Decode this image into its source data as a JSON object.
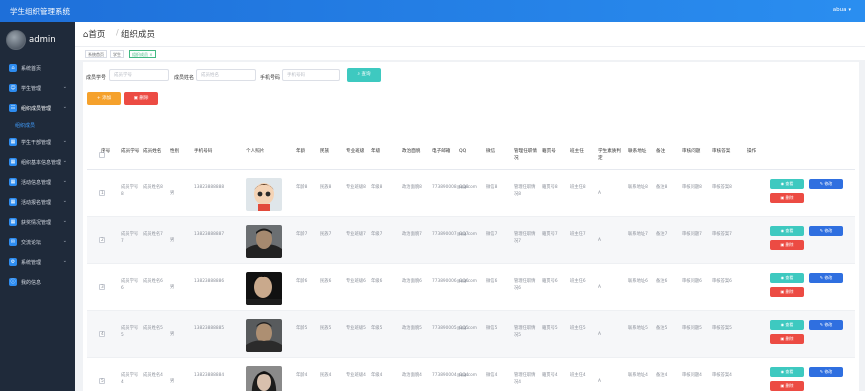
{
  "app": {
    "title": "学生组织管理系统",
    "user": "abua"
  },
  "sidebar": {
    "username": "admin",
    "items": [
      {
        "label": "系统首页",
        "icon": "home-icon"
      },
      {
        "label": "学生管理",
        "icon": "user-icon"
      },
      {
        "label": "组织成员管理",
        "icon": "group-icon"
      },
      {
        "label": "学生干部管理",
        "icon": "grid-icon"
      },
      {
        "label": "组织基本信息管理",
        "icon": "grid-icon"
      },
      {
        "label": "活动信息管理",
        "icon": "grid-icon"
      },
      {
        "label": "活动报名管理",
        "icon": "grid-icon"
      },
      {
        "label": "获奖情况管理",
        "icon": "grid-icon"
      },
      {
        "label": "交流论坛",
        "icon": "chat-icon"
      },
      {
        "label": "系统管理",
        "icon": "gear-icon"
      },
      {
        "label": "我的信息",
        "icon": "info-icon"
      }
    ],
    "subitem": "组织成员"
  },
  "header": {
    "home": "首页",
    "current": "组织成员"
  },
  "tags": [
    "系统首页",
    "学生",
    "组织成员"
  ],
  "search": {
    "fields": [
      {
        "label": "成员学号",
        "placeholder": "成员学号"
      },
      {
        "label": "成员姓名",
        "placeholder": "成员姓名"
      },
      {
        "label": "手机号码",
        "placeholder": "手机号码"
      }
    ],
    "button": "查询"
  },
  "actions": {
    "add": "添加",
    "delete": "删除"
  },
  "table": {
    "headers": [
      "序号",
      "成员学号",
      "成员姓名",
      "性别",
      "手机号码",
      "个人照片",
      "年龄",
      "民族",
      "专业班级",
      "年级",
      "政治面貌",
      "电子邮箱",
      "QQ",
      "微信",
      "管理任职情况",
      "籍贯号",
      "班主任",
      "学生素质判定",
      "联系地址",
      "备注",
      "审核问题",
      "审核答案",
      "操作"
    ],
    "op_view": "查看",
    "op_edit": "修改",
    "op_delete": "删除",
    "rows": [
      {
        "no": "1",
        "sid": "成员学号8",
        "name": "成员姓名8",
        "gender": "男",
        "phone": "13823888888",
        "photo": "cartoon",
        "age": "年龄8",
        "nation": "民族8",
        "cls": "专业班级8",
        "grade": "年级8",
        "political": "政治面貌8",
        "email": "773890008@qq.com",
        "qq": "QQ8",
        "wechat": "微信8",
        "post": "管理任职情况8",
        "jg": "籍贯号8",
        "teacher": "班主任8",
        "quality": "A",
        "addr": "联系地址8",
        "remark": "备注8",
        "q": "审核问题8",
        "a": "审核答案8"
      },
      {
        "no": "2",
        "sid": "成员学号7",
        "name": "成员姓名7",
        "gender": "男",
        "phone": "13823888887",
        "photo": "man1",
        "age": "年龄7",
        "nation": "民族7",
        "cls": "专业班级7",
        "grade": "年级7",
        "political": "政治面貌7",
        "email": "773890007@qq.com",
        "qq": "QQ7",
        "wechat": "微信7",
        "post": "管理任职情况7",
        "jg": "籍贯号7",
        "teacher": "班主任7",
        "quality": "A",
        "addr": "联系地址7",
        "remark": "备注7",
        "q": "审核问题7",
        "a": "审核答案7"
      },
      {
        "no": "3",
        "sid": "成员学号6",
        "name": "成员姓名6",
        "gender": "男",
        "phone": "13823888886",
        "photo": "man2",
        "age": "年龄6",
        "nation": "民族6",
        "cls": "专业班级6",
        "grade": "年级6",
        "political": "政治面貌6",
        "email": "773890006@qq.com",
        "qq": "QQ6",
        "wechat": "微信6",
        "post": "管理任职情况6",
        "jg": "籍贯号6",
        "teacher": "班主任6",
        "quality": "A",
        "addr": "联系地址6",
        "remark": "备注6",
        "q": "审核问题6",
        "a": "审核答案6"
      },
      {
        "no": "4",
        "sid": "成员学号5",
        "name": "成员姓名5",
        "gender": "男",
        "phone": "13823888885",
        "photo": "man3",
        "age": "年龄5",
        "nation": "民族5",
        "cls": "专业班级5",
        "grade": "年级5",
        "political": "政治面貌5",
        "email": "773890005@qq.com",
        "qq": "QQ5",
        "wechat": "微信5",
        "post": "管理任职情况5",
        "jg": "籍贯号5",
        "teacher": "班主任5",
        "quality": "A",
        "addr": "联系地址5",
        "remark": "备注5",
        "q": "审核问题5",
        "a": "审核答案5"
      },
      {
        "no": "5",
        "sid": "成员学号4",
        "name": "成员姓名4",
        "gender": "男",
        "phone": "13823888884",
        "photo": "woman",
        "age": "年龄4",
        "nation": "民族4",
        "cls": "专业班级4",
        "grade": "年级4",
        "political": "政治面貌4",
        "email": "773890004@qq.com",
        "qq": "QQ4",
        "wechat": "微信4",
        "post": "管理任职情况4",
        "jg": "籍贯号4",
        "teacher": "班主任4",
        "quality": "A",
        "addr": "联系地址4",
        "remark": "备注4",
        "q": "审核问题4",
        "a": "审核答案4"
      }
    ]
  },
  "colors": {
    "topbar": "#1e6fd9",
    "sidebar": "#1f2a3a",
    "teal": "#3ec9c0",
    "blue": "#2f6fe0",
    "red": "#ec4b43",
    "orange": "#f5a12c"
  }
}
